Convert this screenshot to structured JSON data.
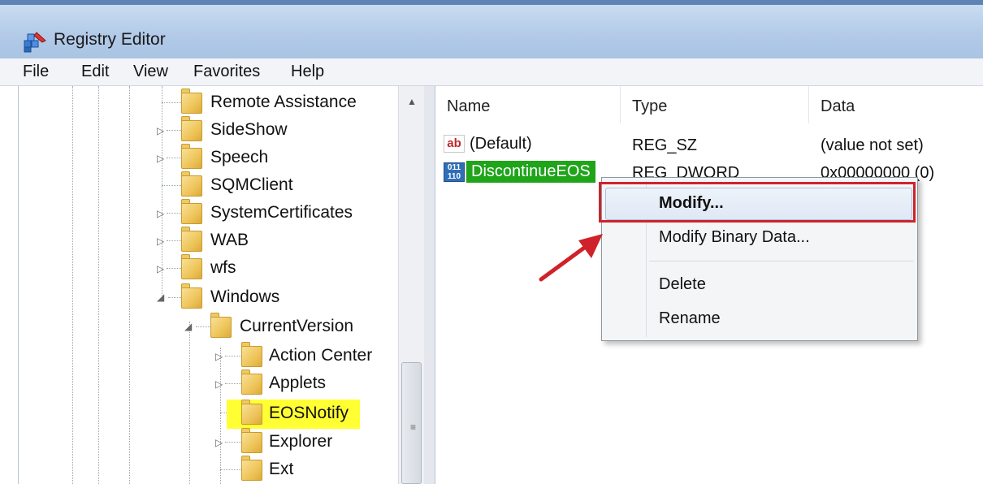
{
  "window": {
    "title": "Registry Editor",
    "icon": "registry-editor-icon"
  },
  "menu": [
    "File",
    "Edit",
    "View",
    "Favorites",
    "Help"
  ],
  "tree": [
    {
      "label": "Remote Assistance",
      "expandable": false
    },
    {
      "label": "SideShow",
      "expandable": true
    },
    {
      "label": "Speech",
      "expandable": true
    },
    {
      "label": "SQMClient",
      "expandable": false
    },
    {
      "label": "SystemCertificates",
      "expandable": true
    },
    {
      "label": "WAB",
      "expandable": true
    },
    {
      "label": "wfs",
      "expandable": true
    },
    {
      "label": "Windows",
      "expandable": true,
      "expanded": true
    },
    {
      "label": "CurrentVersion",
      "expandable": true,
      "expanded": true
    },
    {
      "label": "Action Center",
      "expandable": true
    },
    {
      "label": "Applets",
      "expandable": true
    },
    {
      "label": "EOSNotify",
      "expandable": false,
      "highlighted": true
    },
    {
      "label": "Explorer",
      "expandable": true
    },
    {
      "label": "Ext",
      "expandable": false
    }
  ],
  "columns": [
    "Name",
    "Type",
    "Data"
  ],
  "values": [
    {
      "icon": "string-value-icon",
      "name": "(Default)",
      "type": "REG_SZ",
      "data": "(value not set)"
    },
    {
      "icon": "dword-value-icon",
      "name": "DiscontinueEOS",
      "type": "REG_DWORD",
      "data": "0x00000000 (0)",
      "selected": true
    }
  ],
  "context_menu": {
    "items": [
      "Modify...",
      "Modify Binary Data...",
      "Delete",
      "Rename"
    ],
    "highlighted": "Modify..."
  },
  "colors": {
    "tree_highlight": "#ffff33",
    "selection": "#1fa41a",
    "annotation": "#d0222a"
  }
}
